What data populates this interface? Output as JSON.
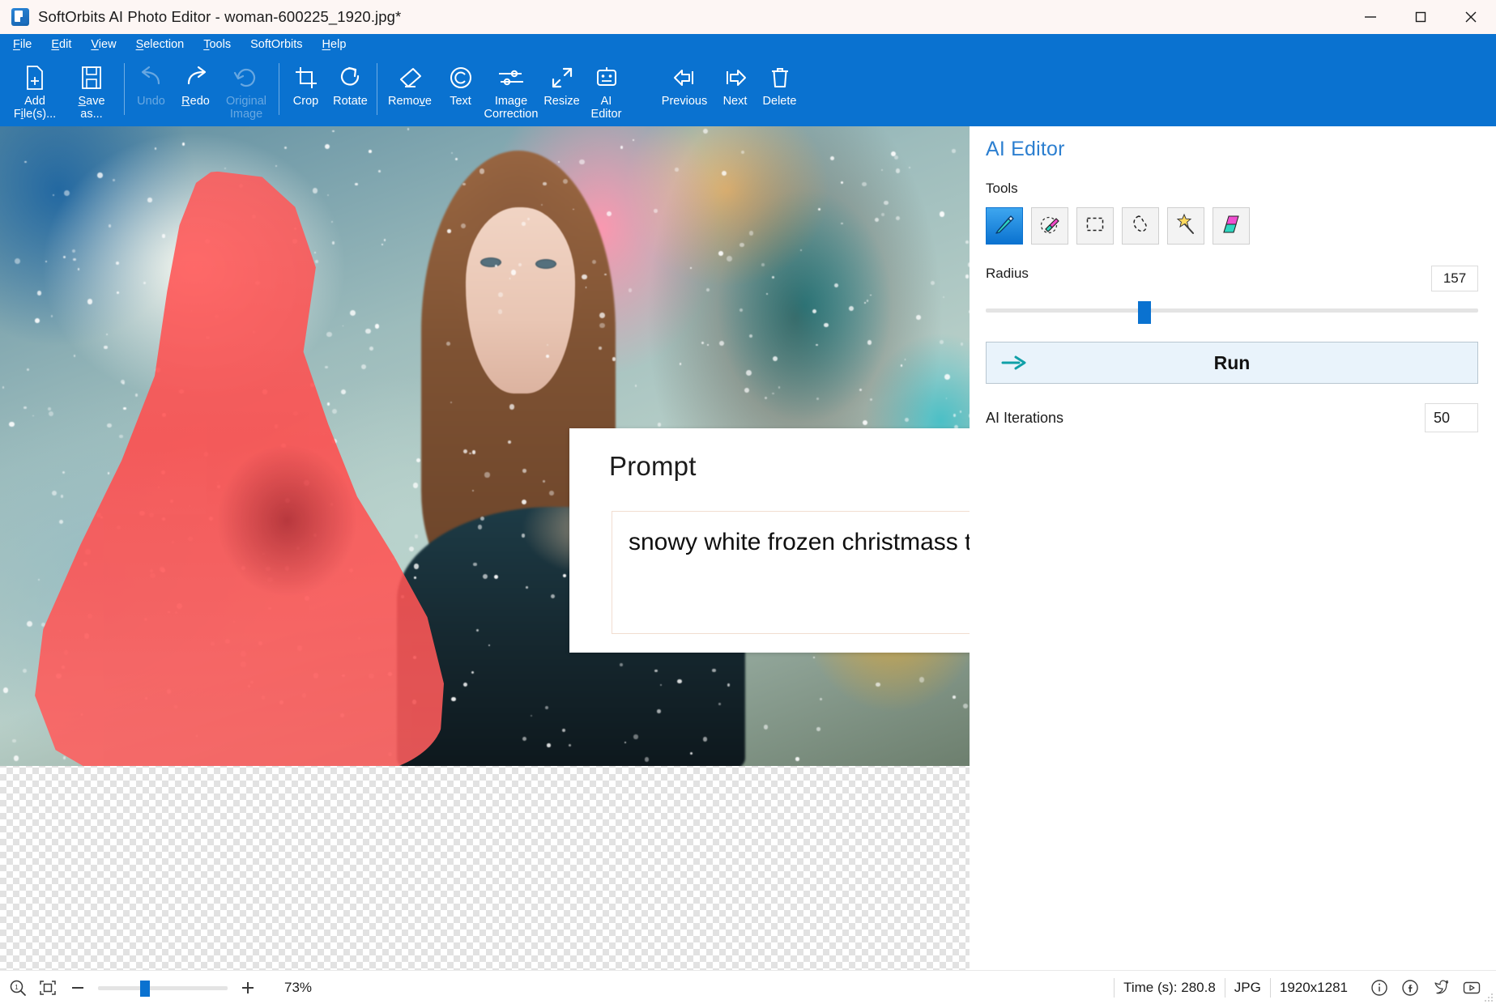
{
  "window": {
    "title": "SoftOrbits AI Photo Editor - woman-600225_1920.jpg*",
    "app_icon": "app-logo-icon",
    "controls": {
      "minimize": "minimize-icon",
      "maximize": "maximize-icon",
      "close": "close-icon"
    }
  },
  "menubar": {
    "items": [
      {
        "label": "File",
        "mnemonic": "F"
      },
      {
        "label": "Edit",
        "mnemonic": "E"
      },
      {
        "label": "View",
        "mnemonic": "V"
      },
      {
        "label": "Selection",
        "mnemonic": "S"
      },
      {
        "label": "Tools",
        "mnemonic": "T"
      },
      {
        "label": "SoftOrbits",
        "mnemonic": ""
      },
      {
        "label": "Help",
        "mnemonic": "H"
      }
    ]
  },
  "toolbar": {
    "buttons": [
      {
        "label": "Add\nFile(s)...",
        "icon": "add-file-icon",
        "enabled": true
      },
      {
        "label": "Save\nas...",
        "icon": "save-icon",
        "enabled": true
      },
      {
        "label": "Undo",
        "icon": "undo-icon",
        "enabled": false
      },
      {
        "label": "Redo",
        "icon": "redo-icon",
        "enabled": true
      },
      {
        "label": "Original\nImage",
        "icon": "original-image-icon",
        "enabled": false
      },
      {
        "label": "Crop",
        "icon": "crop-icon",
        "enabled": true
      },
      {
        "label": "Rotate",
        "icon": "rotate-icon",
        "enabled": true
      },
      {
        "label": "Remove",
        "icon": "eraser-icon",
        "enabled": true
      },
      {
        "label": "Text",
        "icon": "copyright-icon",
        "enabled": true
      },
      {
        "label": "Image\nCorrection",
        "icon": "sliders-icon",
        "enabled": true
      },
      {
        "label": "Resize",
        "icon": "resize-icon",
        "enabled": true
      },
      {
        "label": "AI\nEditor",
        "icon": "robot-icon",
        "enabled": true
      },
      {
        "label": "Previous",
        "icon": "previous-arrow-icon",
        "enabled": true
      },
      {
        "label": "Next",
        "icon": "next-arrow-icon",
        "enabled": true
      },
      {
        "label": "Delete",
        "icon": "trash-icon",
        "enabled": true
      }
    ]
  },
  "prompt_dialog": {
    "title": "Prompt",
    "value": "snowy white frozen christmass tree",
    "placeholder": "",
    "scroll_up_icon": "triangle-up-icon",
    "scroll_down_icon": "triangle-down-icon"
  },
  "panel": {
    "title": "AI Editor",
    "tools_label": "Tools",
    "tools": [
      {
        "name": "marker-tool",
        "icon": "marker-icon",
        "selected": true
      },
      {
        "name": "eraser-tool",
        "icon": "eraser-circle-icon",
        "selected": false
      },
      {
        "name": "rectangle-select",
        "icon": "rectangle-select-icon",
        "selected": false
      },
      {
        "name": "lasso-select",
        "icon": "lasso-icon",
        "selected": false
      },
      {
        "name": "magic-wand",
        "icon": "magic-wand-icon",
        "selected": false
      },
      {
        "name": "gradient-tool",
        "icon": "parallelogram-icon",
        "selected": false
      }
    ],
    "radius": {
      "label": "Radius",
      "value": "157",
      "min": 1,
      "max": 500,
      "percent": 31
    },
    "run": {
      "label": "Run",
      "icon": "run-arrow-icon"
    },
    "iterations": {
      "label": "AI Iterations",
      "value": "50"
    }
  },
  "statusbar": {
    "zoom_one_to_one_icon": "zoom-1-1-icon",
    "fit_icon": "fit-to-window-icon",
    "minus_icon": "minus-icon",
    "plus_icon": "plus-icon",
    "zoom_percent": "73%",
    "time": "Time (s): 280.8",
    "format": "JPG",
    "dimensions": "1920x1281",
    "icons": [
      {
        "name": "info-icon",
        "glyph": "i"
      },
      {
        "name": "facebook-icon",
        "glyph": "f"
      },
      {
        "name": "twitter-icon",
        "glyph": "t"
      },
      {
        "name": "youtube-icon",
        "glyph": "y"
      }
    ]
  },
  "colors": {
    "accent_blue": "#0a72d0",
    "panel_title_blue": "#2c7fd0",
    "mask_red": "#ff4d4d",
    "run_bg": "#e9f3fb",
    "run_arrow_teal": "#10a0a8"
  }
}
